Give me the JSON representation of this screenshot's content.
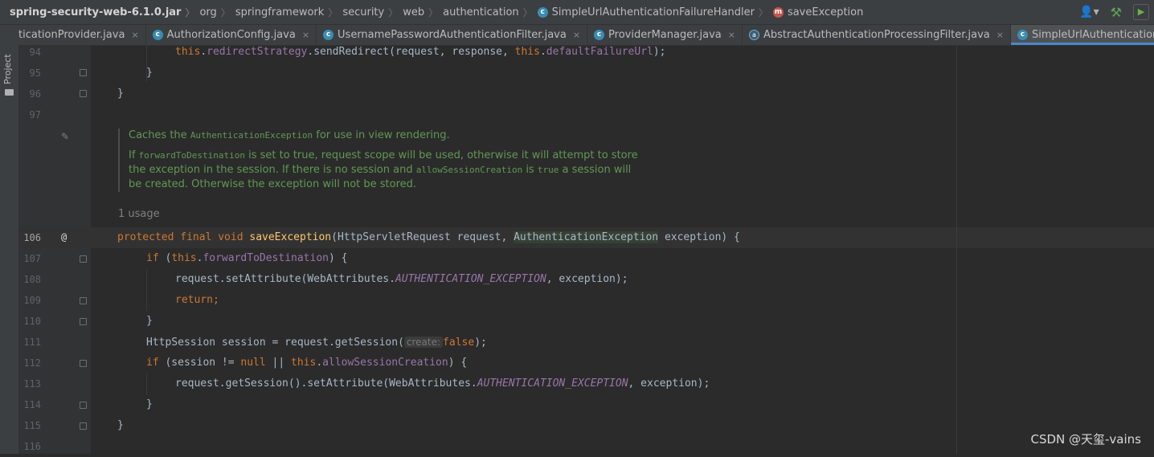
{
  "breadcrumb": [
    {
      "label": "spring-security-web-6.1.0.jar",
      "kind": "root"
    },
    {
      "label": "org",
      "kind": "package"
    },
    {
      "label": "springframework",
      "kind": "package"
    },
    {
      "label": "security",
      "kind": "package"
    },
    {
      "label": "web",
      "kind": "package"
    },
    {
      "label": "authentication",
      "kind": "package"
    },
    {
      "label": "SimpleUrlAuthenticationFailureHandler",
      "kind": "class",
      "icon": "c"
    },
    {
      "label": "saveException",
      "kind": "method",
      "icon": "m"
    }
  ],
  "toolstrip": {
    "project_label": "Project"
  },
  "tabs": [
    {
      "label": "ticationProvider.java",
      "icon": "",
      "active": false
    },
    {
      "label": "AuthorizationConfig.java",
      "icon": "c",
      "active": false
    },
    {
      "label": "UsernamePasswordAuthenticationFilter.java",
      "icon": "c",
      "active": false
    },
    {
      "label": "ProviderManager.java",
      "icon": "c",
      "active": false
    },
    {
      "label": "AbstractAuthenticationProcessingFilter.java",
      "icon": "a",
      "active": false
    },
    {
      "label": "SimpleUrlAuthenticationFailureHandler.java",
      "icon": "c",
      "active": true
    }
  ],
  "tab_close_glyph": "×",
  "line_numbers": [
    "94",
    "95",
    "96",
    "97",
    "106",
    "107",
    "108",
    "109",
    "110",
    "111",
    "112",
    "113",
    "114",
    "115",
    "116"
  ],
  "doc": {
    "p1_pre": "Caches the ",
    "p1_code": "AuthenticationException",
    "p1_post": " for use in view rendering.",
    "p2_a": "If ",
    "p2_code1": "forwardToDestination",
    "p2_b": " is set to true, request scope will be used, otherwise it will attempt to store",
    "p2_c": "the exception in the session. If there is no session and ",
    "p2_code2": "allowSessionCreation",
    "p2_d": " is ",
    "p2_code3": "true",
    "p2_e": " a session will",
    "p2_f": "be created. Otherwise the exception will not be stored."
  },
  "usage_hint": "1 usage",
  "impl_marker": "@",
  "code": {
    "l94": {
      "a": "this",
      "b": ".",
      "c": "redirectStrategy",
      "d": ".sendRedirect(request, response, ",
      "e": "this",
      "f": ".",
      "g": "defaultFailureUrl",
      "h": ");"
    },
    "l95": "}",
    "l96": "}",
    "l106": {
      "kw": "protected final void ",
      "fn": "saveException",
      "a": "(HttpServletRequest request, ",
      "hl": "AuthenticationException",
      "b": " exception) {"
    },
    "l107": {
      "kw": "if ",
      "a": "(",
      "kw2": "this",
      "b": ".",
      "fld": "forwardToDestination",
      "c": ") {"
    },
    "l108": {
      "a": "request.setAttribute(WebAttributes.",
      "cst": "AUTHENTICATION_EXCEPTION",
      "b": ", exception);"
    },
    "l109": "return;",
    "l110": "}",
    "l111": {
      "a": "HttpSession session = request.getSession(",
      "hint": "create:",
      "kw": "false",
      "b": ");"
    },
    "l112": {
      "kw": "if ",
      "a": "(session != ",
      "kw2": "null",
      "b": " || ",
      "kw3": "this",
      "c": ".",
      "fld": "allowSessionCreation",
      "d": ") {"
    },
    "l113": {
      "a": "request.getSession().setAttribute(WebAttributes.",
      "cst": "AUTHENTICATION_EXCEPTION",
      "b": ", exception);"
    },
    "l114": "}",
    "l115": "}"
  },
  "watermark": "CSDN @天玺-vains",
  "colors": {
    "keyword": "#cc7832",
    "field": "#9876aa",
    "function": "#ffc66d",
    "doc": "#629755",
    "text": "#a9b7c6",
    "tab_underline": "#4a88c7"
  }
}
